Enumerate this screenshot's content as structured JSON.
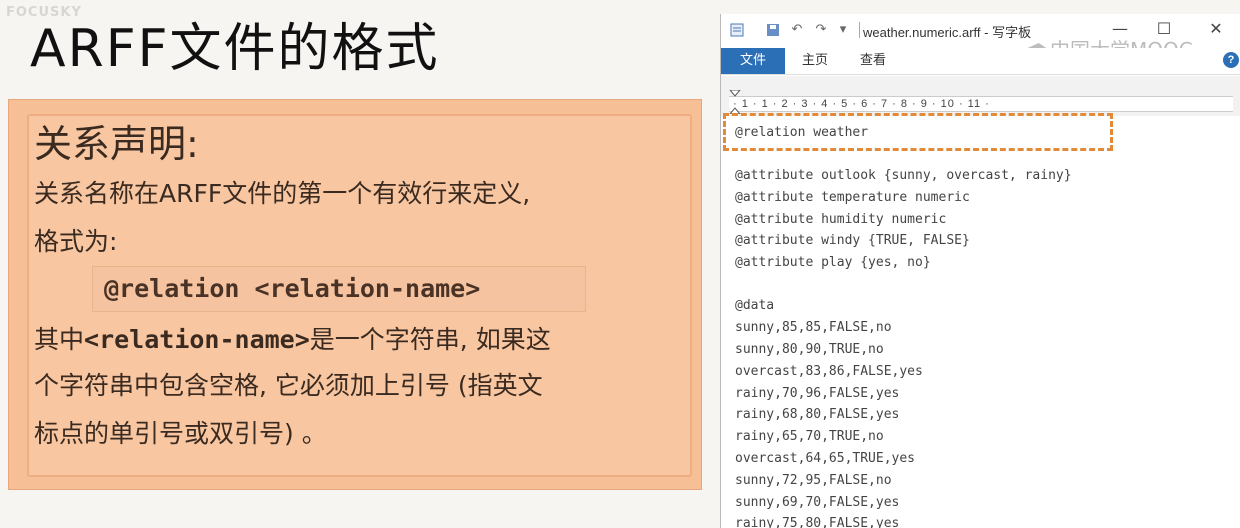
{
  "slide": {
    "watermark": "FOCUSKY",
    "title": "ARFF文件的格式",
    "heading": "关系声明:",
    "line1": "关系名称在ARFF文件的第一个有效行来定义,",
    "line2": "格式为:",
    "code": "@relation <relation-name>",
    "line3_code": "<relation-name>",
    "line3_pre": "其中",
    "line3_post": "是一个字符串, 如果这",
    "line4": "个字符串中包含空格, 它必须加上引号 (指英文",
    "line5": "标点的单引号或双引号) 。"
  },
  "wordpad": {
    "title": "weather.numeric.arff - 写字板",
    "tabs": [
      "文件",
      "主页",
      "查看"
    ],
    "watermark": "中国大学MOOC",
    "help": "?",
    "controls": {
      "minimize": "—",
      "maximize": "☐",
      "close": "✕"
    },
    "ruler": "· 1 · 1 · 2 · 3 · 4 · 5 · 6 · 7 · 8 · 9 · 10 · 11 ·",
    "lines": [
      "@relation weather",
      "",
      "@attribute outlook {sunny, overcast, rainy}",
      "@attribute temperature numeric",
      "@attribute humidity numeric",
      "@attribute windy {TRUE, FALSE}",
      "@attribute play {yes, no}",
      "",
      "@data",
      "sunny,85,85,FALSE,no",
      "sunny,80,90,TRUE,no",
      "overcast,83,86,FALSE,yes",
      "rainy,70,96,FALSE,yes",
      "rainy,68,80,FALSE,yes",
      "rainy,65,70,TRUE,no",
      "overcast,64,65,TRUE,yes",
      "sunny,72,95,FALSE,no",
      "sunny,69,70,FALSE,yes",
      "rainy,75,80,FALSE,yes"
    ]
  },
  "colors": {
    "card": "#f6bf96",
    "accent_tab": "#2b6fb6",
    "highlight_dash": "#e08a3a"
  }
}
